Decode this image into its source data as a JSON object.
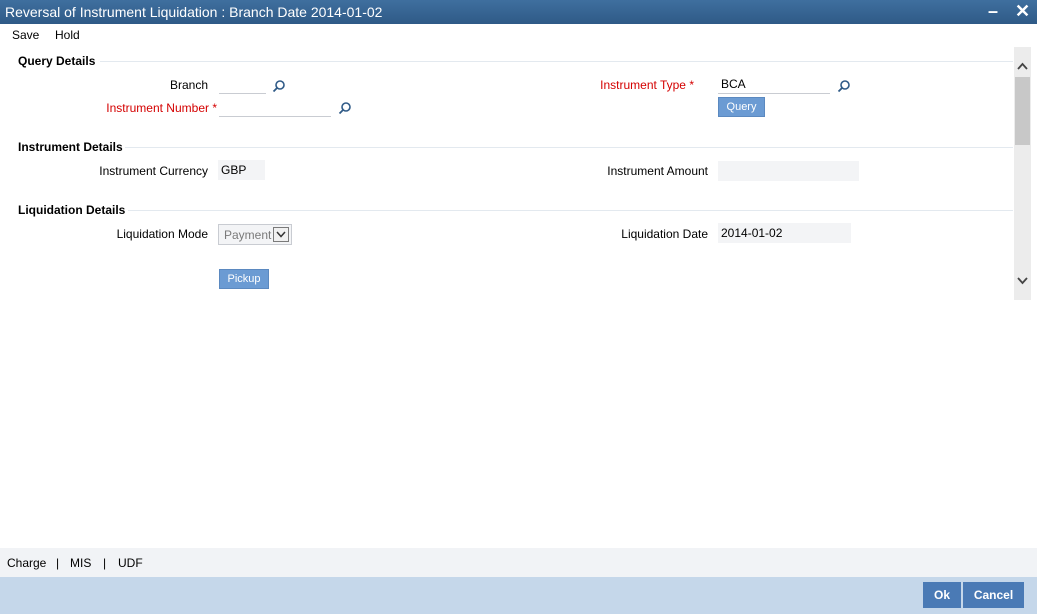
{
  "window": {
    "title": "Reversal of Instrument Liquidation : Branch Date 2014-01-02",
    "minimize_glyph": "–",
    "close_glyph": "✕"
  },
  "menu": {
    "save": "Save",
    "hold": "Hold"
  },
  "query_details": {
    "title": "Query Details",
    "branch_label": "Branch",
    "branch_value": "",
    "instrument_number_label": "Instrument Number",
    "instrument_number_value": "",
    "instrument_type_label": "Instrument Type",
    "instrument_type_value": "BCA",
    "required_marker": "*",
    "query_button": "Query"
  },
  "instrument_details": {
    "title": "Instrument Details",
    "currency_label": "Instrument Currency",
    "currency_value": "GBP",
    "amount_label": "Instrument Amount",
    "amount_value": ""
  },
  "liquidation_details": {
    "title": "Liquidation Details",
    "mode_label": "Liquidation Mode",
    "mode_value": "Payment",
    "date_label": "Liquidation Date",
    "date_value": "2014-01-02",
    "pickup_button": "Pickup"
  },
  "footer_tabs": {
    "charge": "Charge",
    "mis": "MIS",
    "udf": "UDF",
    "separator": "|"
  },
  "actions": {
    "ok": "Ok",
    "cancel": "Cancel"
  },
  "colors": {
    "title_bar": "#2f5a87",
    "required": "#d40000",
    "button_blue": "#6b9bd3",
    "action_button": "#4a7ab5",
    "bottom_bar": "#c5d7ea"
  },
  "icons": {
    "lov": "magnifier-icon",
    "scroll_up": "chevron-up-icon",
    "scroll_down": "chevron-down-icon",
    "dropdown": "chevron-down-icon"
  }
}
